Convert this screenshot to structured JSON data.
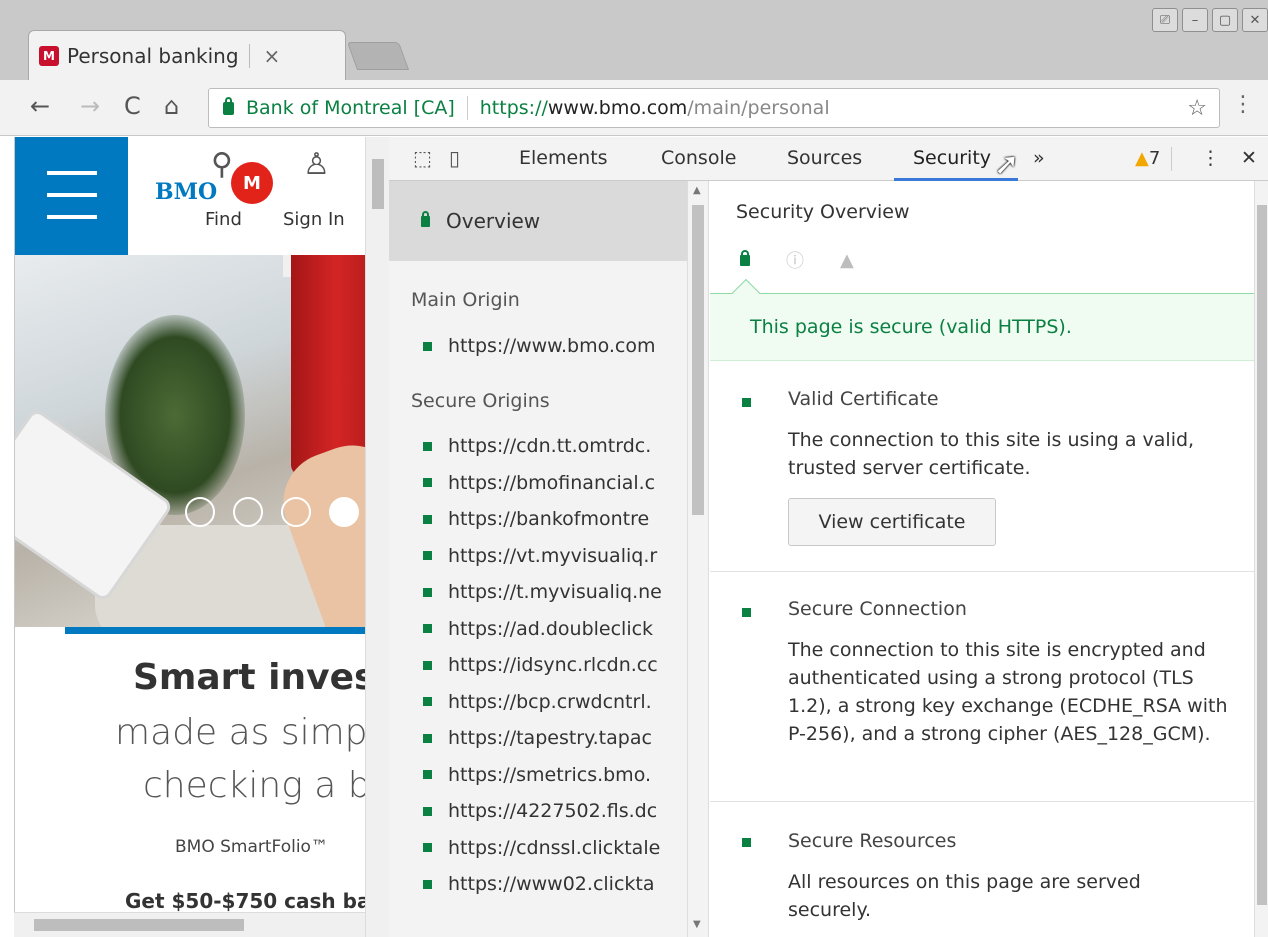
{
  "browser": {
    "tab_title": "Personal banking",
    "tab_close": "×",
    "window_controls": [
      "⎚",
      "–",
      "▢",
      "✕"
    ],
    "nav": {
      "back": "←",
      "forward": "→",
      "reload": "C",
      "home": "⌂"
    },
    "omnibox": {
      "org": "Bank of Montreal [CA]",
      "url_scheme": "https://",
      "url_host": "www.bmo.com",
      "url_path": "/main/personal"
    },
    "star": "☆",
    "menu": "⋮"
  },
  "page": {
    "logo": "BMO",
    "logo_mark": "M",
    "find_label": "Find",
    "signin_label": "Sign In",
    "headline": "Smart investi",
    "sub1": "made as simpl",
    "sub2": "checking a bc",
    "small": "BMO SmartFolio™",
    "small2": "Get $50-$750 cash ba"
  },
  "devtools": {
    "tabs": [
      "Elements",
      "Console",
      "Sources",
      "Security"
    ],
    "active_tab": "Security",
    "more": "»",
    "warnings": "7",
    "menu": "⋮",
    "close": "✕",
    "sidebar": {
      "overview": "Overview",
      "main_origin_heading": "Main Origin",
      "main_origin": "https://www.bmo.com",
      "secure_origins_heading": "Secure Origins",
      "secure_origins": [
        "https://cdn.tt.omtrdc.",
        "https://bmofinancial.c",
        "https://bankofmontre",
        "https://vt.myvisualiq.r",
        "https://t.myvisualiq.ne",
        "https://ad.doubleclick",
        "https://idsync.rlcdn.cc",
        "https://bcp.crwdcntrl.",
        "https://tapestry.tapac",
        "https://smetrics.bmo.",
        "https://4227502.fls.dc",
        "https://cdnssl.clicktale",
        "https://www02.clickta"
      ]
    },
    "main": {
      "title": "Security Overview",
      "banner": "This page is secure (valid HTTPS).",
      "cards": [
        {
          "title": "Valid Certificate",
          "text": "The connection to this site is using a valid, trusted server certificate.",
          "button": "View certificate"
        },
        {
          "title": "Secure Connection",
          "text": "The connection to this site is encrypted and authenticated using a strong protocol (TLS 1.2), a strong key exchange (ECDHE_RSA with P-256), and a strong cipher (AES_128_GCM)."
        },
        {
          "title": "Secure Resources",
          "text": "All resources on this page are served securely."
        }
      ]
    }
  },
  "colors": {
    "secure_green": "#0b8043",
    "bmo_blue": "#0079c1",
    "bmo_red": "#e2231a",
    "devtools_active": "#3879d9",
    "warning": "#f2a600"
  }
}
